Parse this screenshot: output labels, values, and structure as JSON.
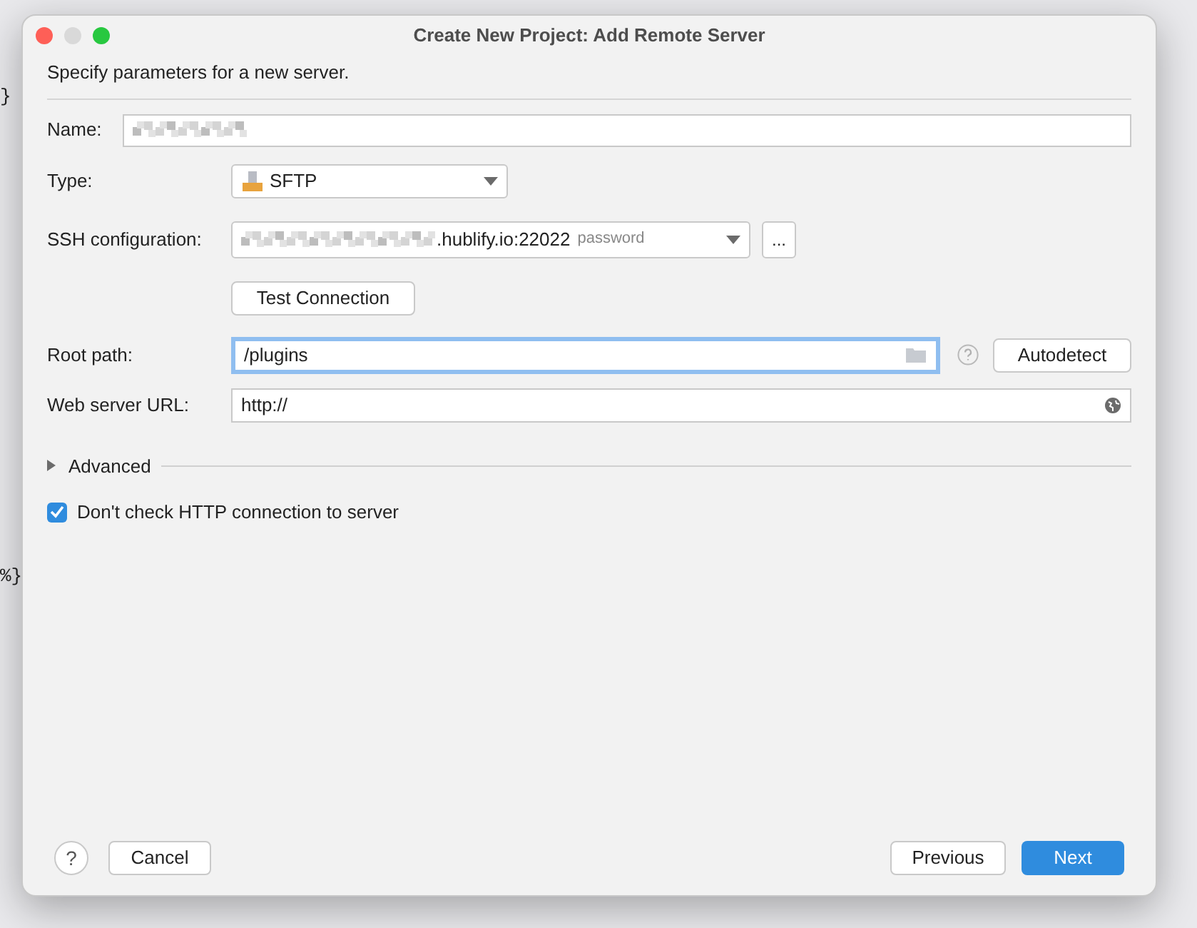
{
  "background_code": [
    {
      "text": "}"
    },
    {
      "text": "%}"
    }
  ],
  "window": {
    "title": "Create New Project: Add Remote Server"
  },
  "description": "Specify parameters for a new server.",
  "name_field": {
    "label": "Name:"
  },
  "type_field": {
    "label": "Type:",
    "value": "SFTP"
  },
  "ssh_field": {
    "label": "SSH configuration:",
    "value": ".hublify.io:22022",
    "hint": "password",
    "more_button": "..."
  },
  "test_button": "Test Connection",
  "root_path": {
    "label": "Root path:",
    "value": "/plugins",
    "focused": true,
    "autodetect_button": "Autodetect"
  },
  "web_url": {
    "label": "Web server URL:",
    "value": "http://"
  },
  "advanced": {
    "label": "Advanced",
    "expanded": false
  },
  "http_check": {
    "label": "Don't check HTTP connection to server",
    "checked": true
  },
  "footer": {
    "help": "?",
    "cancel": "Cancel",
    "previous": "Previous",
    "next": "Next"
  }
}
